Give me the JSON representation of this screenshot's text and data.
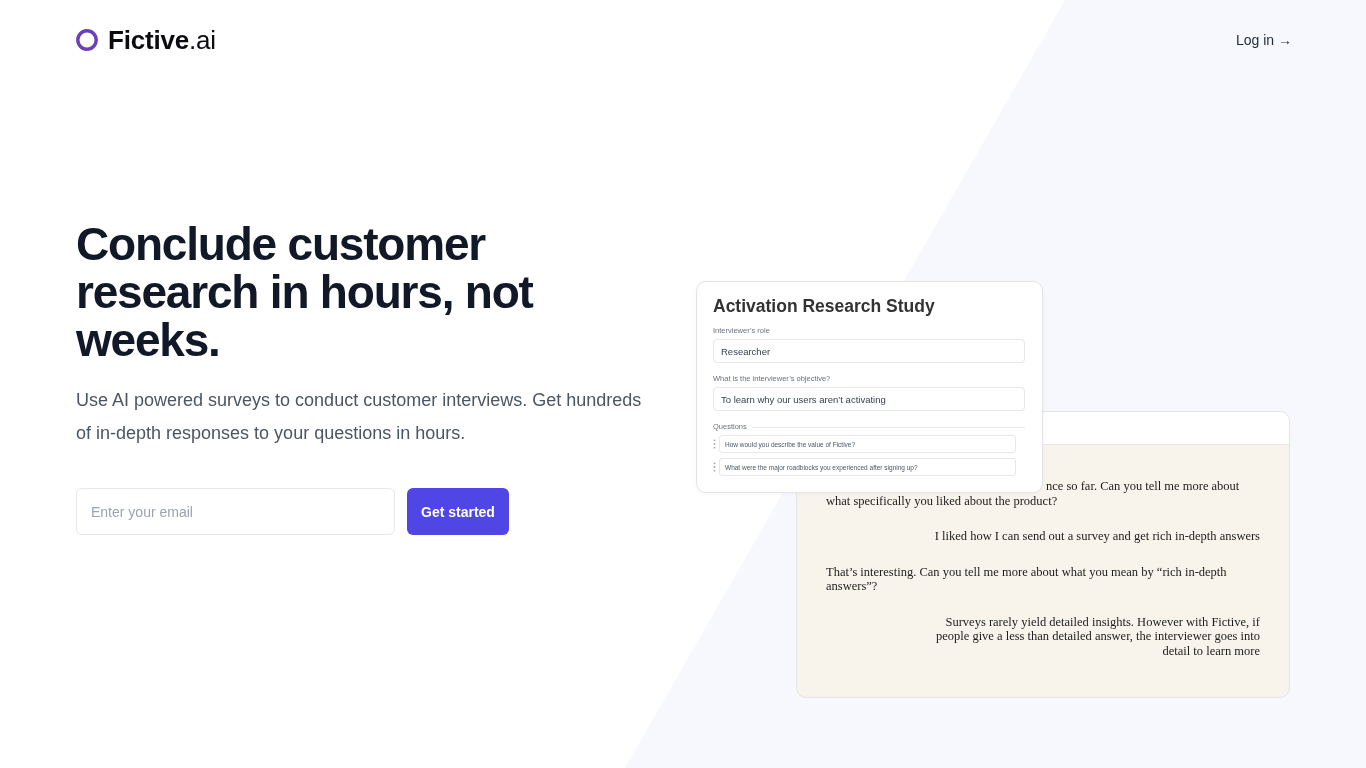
{
  "header": {
    "logo": {
      "text": "**Fictive**.ai"
    },
    "login_link": "Log in →"
  },
  "hero": {
    "headline": "Conclude customer research in hours, not weeks.",
    "description": "Use AI powered surveys to conduct customer interviews. Get hundreds of in-depth responses to your questions in hours.",
    "email_field": {
      "placeholder": "Enter your email"
    },
    "cta_button": "Get started"
  },
  "study_card": {
    "title": "Activation Research Study",
    "fields": [
      {
        "label": "Interviewer’s role",
        "value": "Researcher"
      },
      {
        "label": "What is the interviewer’s objective?",
        "value": "To learn why our users aren’t activating"
      }
    ],
    "questions_label": "Questions",
    "questions": [
      "How would you describe the value of Fictive?",
      "What were the major roadblocks you experienced after signing up?"
    ]
  },
  "chat_card": {
    "messages": [
      {
        "kind": "interviewer",
        "text": "nce so far. Can you tell me more about what specifically you liked about the product?"
      },
      {
        "kind": "respondent",
        "text": "I liked how I can send out a survey and get rich in-depth answers"
      },
      {
        "kind": "interviewer",
        "text": "That’s interesting. Can you tell me more about what you mean by “rich in-depth answers”?"
      },
      {
        "kind": "respondent",
        "text": "Surveys rarely yield detailed insights. However with Fictive, if people give a less than detailed answer, the interviewer goes into detail to learn more"
      }
    ]
  }
}
